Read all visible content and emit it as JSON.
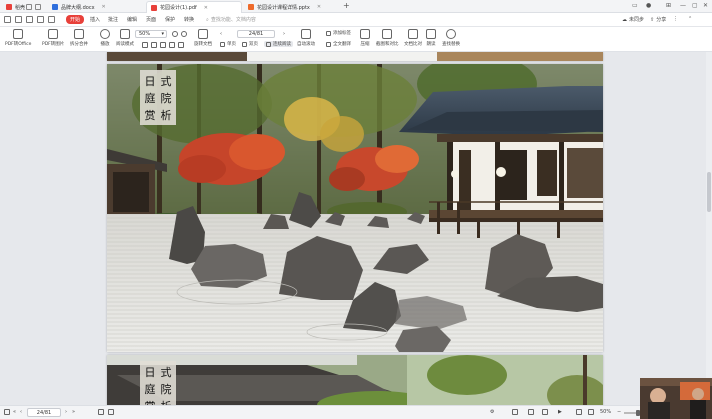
{
  "tabs": [
    {
      "label": "稻壳",
      "color": "#e8403a",
      "active": false
    },
    {
      "label": "品牌大纲.docx",
      "color": "#2f6fdd",
      "active": false
    },
    {
      "label": "花园设计(1).pdf",
      "color": "#e8403a",
      "active": true
    },
    {
      "label": "花园设计课程详情.pptx",
      "color": "#ee6a2b",
      "active": false
    }
  ],
  "menu": {
    "start": "开始",
    "items": [
      "插入",
      "批注",
      "编辑",
      "页面",
      "保护",
      "转换"
    ],
    "search_placeholder": "查找功能、文档内容",
    "right": {
      "unsync": "未同步",
      "share": "分享"
    }
  },
  "ribbon": {
    "pdf_to_office": "PDF转Office",
    "pdf_to_image": "PDF转图片",
    "split_merge": "拆分合并",
    "play": "播放",
    "read_mode": "阅读模式",
    "zoom": "50%",
    "rotate_doc": "旋转文档",
    "page_value": "24/81",
    "single_page": "单页",
    "double_page": "双页",
    "continuous_read": "连续阅读",
    "auto_scroll": "自动滚动",
    "add_bookmark": "添加标签",
    "full_translate": "全文翻译",
    "compress": "压缩",
    "screenshot_compare": "截图和对比",
    "doc_compare": "文档比对",
    "read_aloud": "朗读",
    "find_replace": "查找替换"
  },
  "pages": [
    {
      "title_chars": [
        "日",
        "式",
        "庭",
        "院",
        "赏",
        "析"
      ]
    },
    {
      "title_chars": [
        "日",
        "式",
        "庭",
        "院",
        "赏",
        "析"
      ]
    }
  ],
  "status": {
    "page": "24/81",
    "zoom": "50%"
  },
  "colors": {
    "accent": "#e8403a",
    "background": "#e6e8ec"
  }
}
